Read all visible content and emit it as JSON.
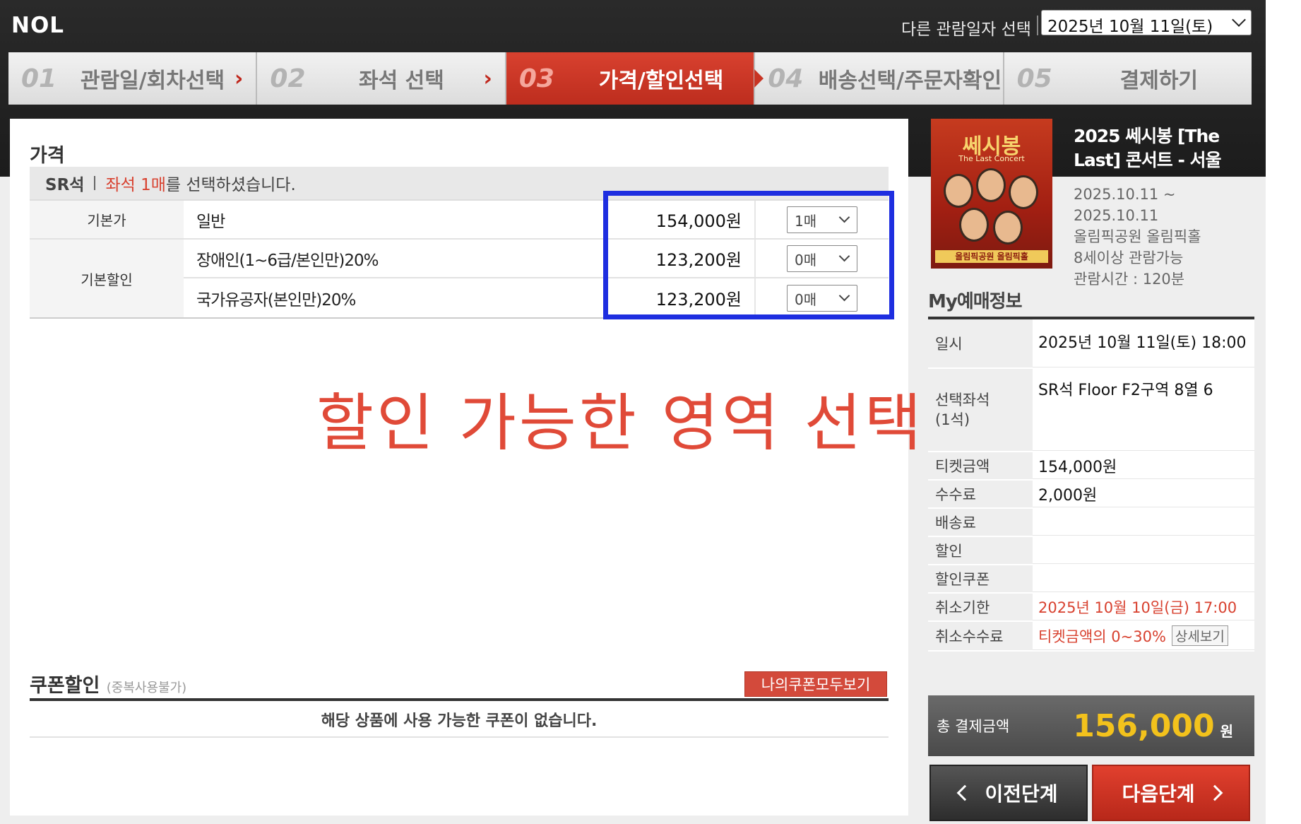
{
  "app": {
    "logo": "NOL",
    "date_label": "다른 관람일자 선택",
    "date_value": "2025년 10월 11일(토)"
  },
  "steps": [
    {
      "num": "01",
      "label": "관람일/회차선택",
      "arrow": "›"
    },
    {
      "num": "02",
      "label": "좌석 선택",
      "arrow": "›"
    },
    {
      "num": "03",
      "label": "가격/할인선택",
      "arrow": ""
    },
    {
      "num": "04",
      "label": "배송선택/주문자확인",
      "arrow": ""
    },
    {
      "num": "05",
      "label": "결제하기",
      "arrow": ""
    }
  ],
  "price": {
    "section_title": "가격",
    "grade": "SR석",
    "selected_prefix": "좌석 1매",
    "selected_suffix": "를 선택하셨습니다.",
    "rows": [
      {
        "category": "기본가",
        "name": "일반",
        "price": "154,000원",
        "qty": "1매"
      },
      {
        "category": "기본할인",
        "name": "장애인(1~6급/본인만)20%",
        "price": "123,200원",
        "qty": "0매"
      },
      {
        "category": "",
        "name": "국가유공자(본인만)20%",
        "price": "123,200원",
        "qty": "0매"
      }
    ]
  },
  "annotation": "할인 가능한 영역 선택",
  "coupon": {
    "title": "쿠폰할인",
    "note": "(중복사용불가)",
    "button": "나의쿠폰모두보기",
    "empty": "해당 상품에 사용 가능한 쿠폰이 없습니다."
  },
  "show": {
    "poster_title": "쎄시봉",
    "poster_sub": "The Last Concert",
    "poster_foot": "올림픽공원 올림픽홀",
    "title": "2025 쎄시봉 [The Last] 콘서트 - 서울",
    "period_start": "2025.10.11 ~",
    "period_end": "2025.10.11",
    "venue": "올림픽공원 올림픽홀",
    "age": "8세이상 관람가능",
    "runtime": "관람시간 : 120분"
  },
  "my": {
    "title": "My예매정보",
    "rows": [
      {
        "k": "일시",
        "v": "2025년 10월 11일(토) 18:00"
      },
      {
        "k": "선택좌석\n(1석)",
        "v": "SR석 Floor F2구역 8열 6"
      },
      {
        "k": "티켓금액",
        "v": "154,000원"
      },
      {
        "k": "수수료",
        "v": "2,000원"
      },
      {
        "k": "배송료",
        "v": ""
      },
      {
        "k": "할인",
        "v": ""
      },
      {
        "k": "할인쿠폰",
        "v": ""
      },
      {
        "k": "취소기한",
        "v": "2025년 10월 10일(금) 17:00"
      },
      {
        "k": "취소수수료",
        "v": "티켓금액의 0~30%"
      }
    ],
    "detail_button": "상세보기",
    "total_label": "총 결제금액",
    "total_value": "156,000",
    "total_unit": "원"
  },
  "nav": {
    "prev": "이전단계",
    "next": "다음단계"
  },
  "colors": {
    "accent_red": "#d8412f",
    "highlight_blue": "#1e2ee0",
    "total_yellow": "#f3c21c"
  }
}
